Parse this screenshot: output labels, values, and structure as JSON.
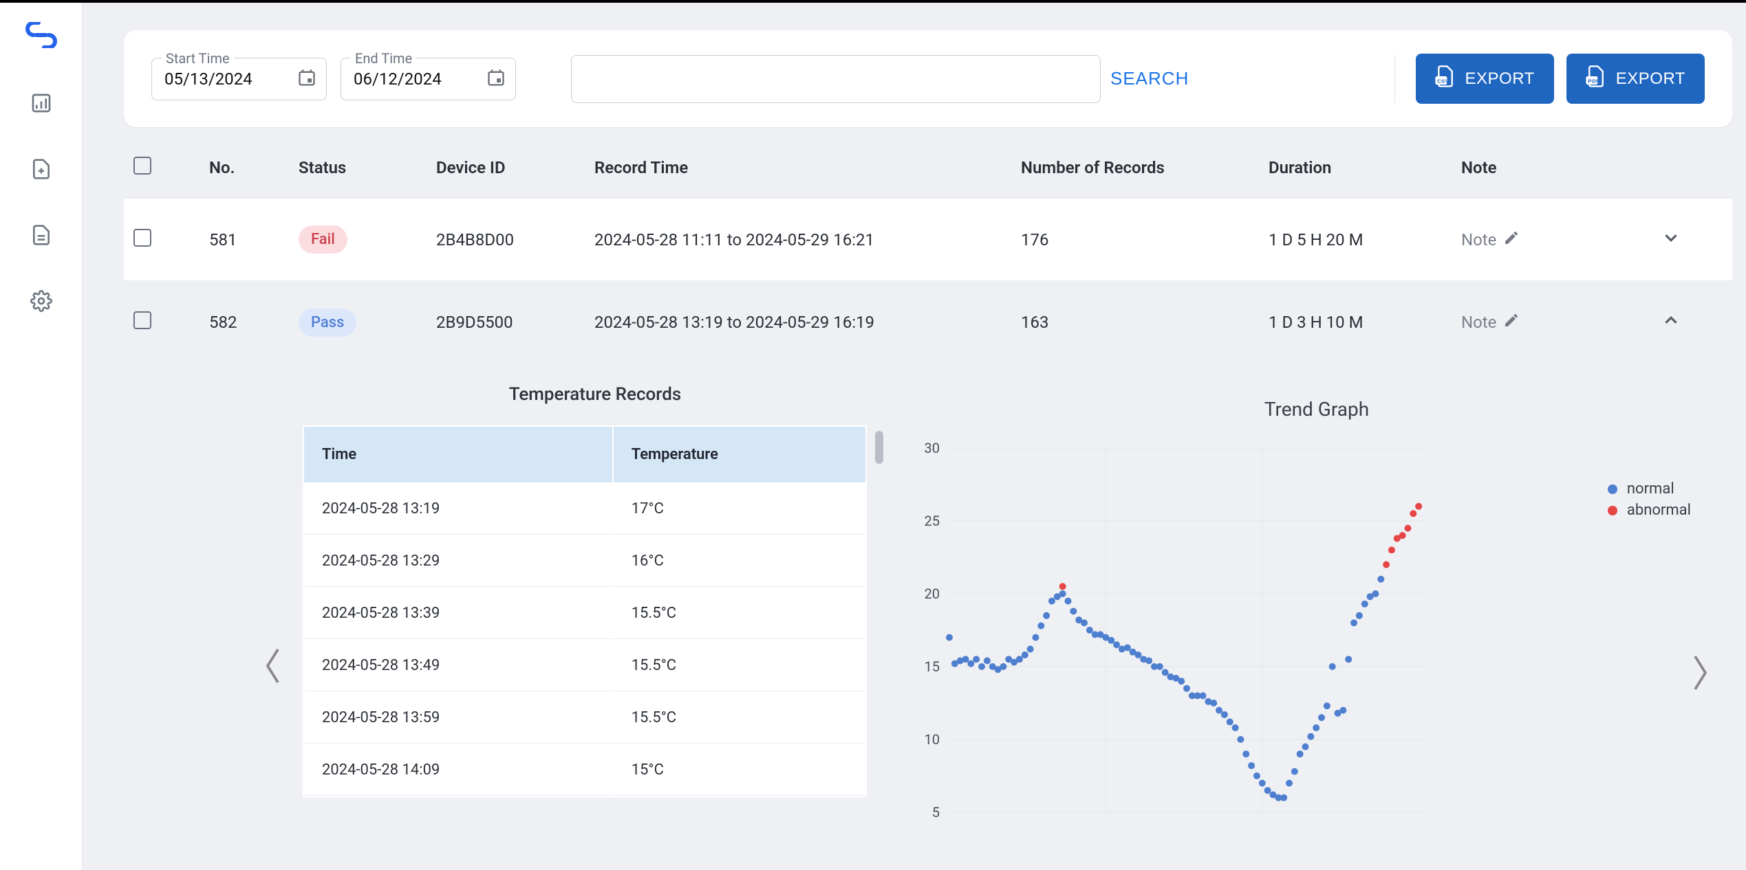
{
  "filter": {
    "start_label": "Start Time",
    "start_value": "05/13/2024",
    "end_label": "End Time",
    "end_value": "06/12/2024",
    "search_btn": "SEARCH",
    "export_csv": "EXPORT",
    "export_pdf": "EXPORT"
  },
  "table": {
    "headers": {
      "no": "No.",
      "status": "Status",
      "device": "Device ID",
      "record_time": "Record Time",
      "num_records": "Number of Records",
      "duration": "Duration",
      "note": "Note"
    },
    "rows": [
      {
        "no": "581",
        "status": "Fail",
        "device": "2B4B8D00",
        "record_time": "2024-05-28 11:11 to 2024-05-29 16:21",
        "num_records": "176",
        "duration": "1 D 5 H 20 M",
        "note": "Note"
      },
      {
        "no": "582",
        "status": "Pass",
        "device": "2B9D5500",
        "record_time": "2024-05-28 13:19 to 2024-05-29 16:19",
        "num_records": "163",
        "duration": "1 D 3 H 10 M",
        "note": "Note"
      }
    ]
  },
  "detail": {
    "records_title": "Temperature Records",
    "records_headers": {
      "time": "Time",
      "temp": "Temperature"
    },
    "records": [
      {
        "time": "2024-05-28 13:19",
        "temp": "17°C"
      },
      {
        "time": "2024-05-28 13:29",
        "temp": "16°C"
      },
      {
        "time": "2024-05-28 13:39",
        "temp": "15.5°C"
      },
      {
        "time": "2024-05-28 13:49",
        "temp": "15.5°C"
      },
      {
        "time": "2024-05-28 13:59",
        "temp": "15.5°C"
      },
      {
        "time": "2024-05-28 14:09",
        "temp": "15°C"
      }
    ],
    "chart_title": "Trend Graph",
    "legend_normal": "normal",
    "legend_abnormal": "abnormal"
  },
  "chart_data": {
    "type": "scatter",
    "title": "Trend Graph",
    "ylabel": "",
    "xlabel": "",
    "ylim": [
      5,
      30
    ],
    "yticks": [
      5,
      10,
      15,
      20,
      25,
      30
    ],
    "legend": [
      "normal",
      "abnormal"
    ],
    "normal": [
      17,
      15.2,
      15.4,
      15.5,
      15.2,
      15.5,
      15,
      15.4,
      15,
      14.8,
      15,
      15.5,
      15.3,
      15.5,
      15.8,
      16.2,
      17,
      17.8,
      18.5,
      19.5,
      19.8,
      20,
      19.5,
      18.8,
      18.2,
      18,
      17.5,
      17.2,
      17.2,
      17,
      16.8,
      16.5,
      16.2,
      16.3,
      16,
      15.8,
      15.5,
      15.4,
      15,
      15,
      14.6,
      14.3,
      14.2,
      14,
      13.5,
      13,
      13,
      13,
      12.6,
      12.5,
      12,
      11.7,
      11.2,
      10.8,
      10,
      9,
      8.2,
      7.5,
      7,
      6.5,
      6.2,
      6,
      6,
      7,
      7.8,
      9,
      9.5,
      10.2,
      10.8,
      11.5,
      12.3,
      15,
      11.8,
      12,
      15.5,
      18,
      18.5,
      19.3,
      19.8,
      20,
      21
    ],
    "abnormal": [
      {
        "i": 21,
        "y": 20.5
      },
      {
        "i": 81,
        "y": 22
      },
      {
        "i": 82,
        "y": 23
      },
      {
        "i": 83,
        "y": 23.8
      },
      {
        "i": 84,
        "y": 24
      },
      {
        "i": 85,
        "y": 24.5
      },
      {
        "i": 86,
        "y": 25.5
      },
      {
        "i": 87,
        "y": 26
      }
    ]
  }
}
